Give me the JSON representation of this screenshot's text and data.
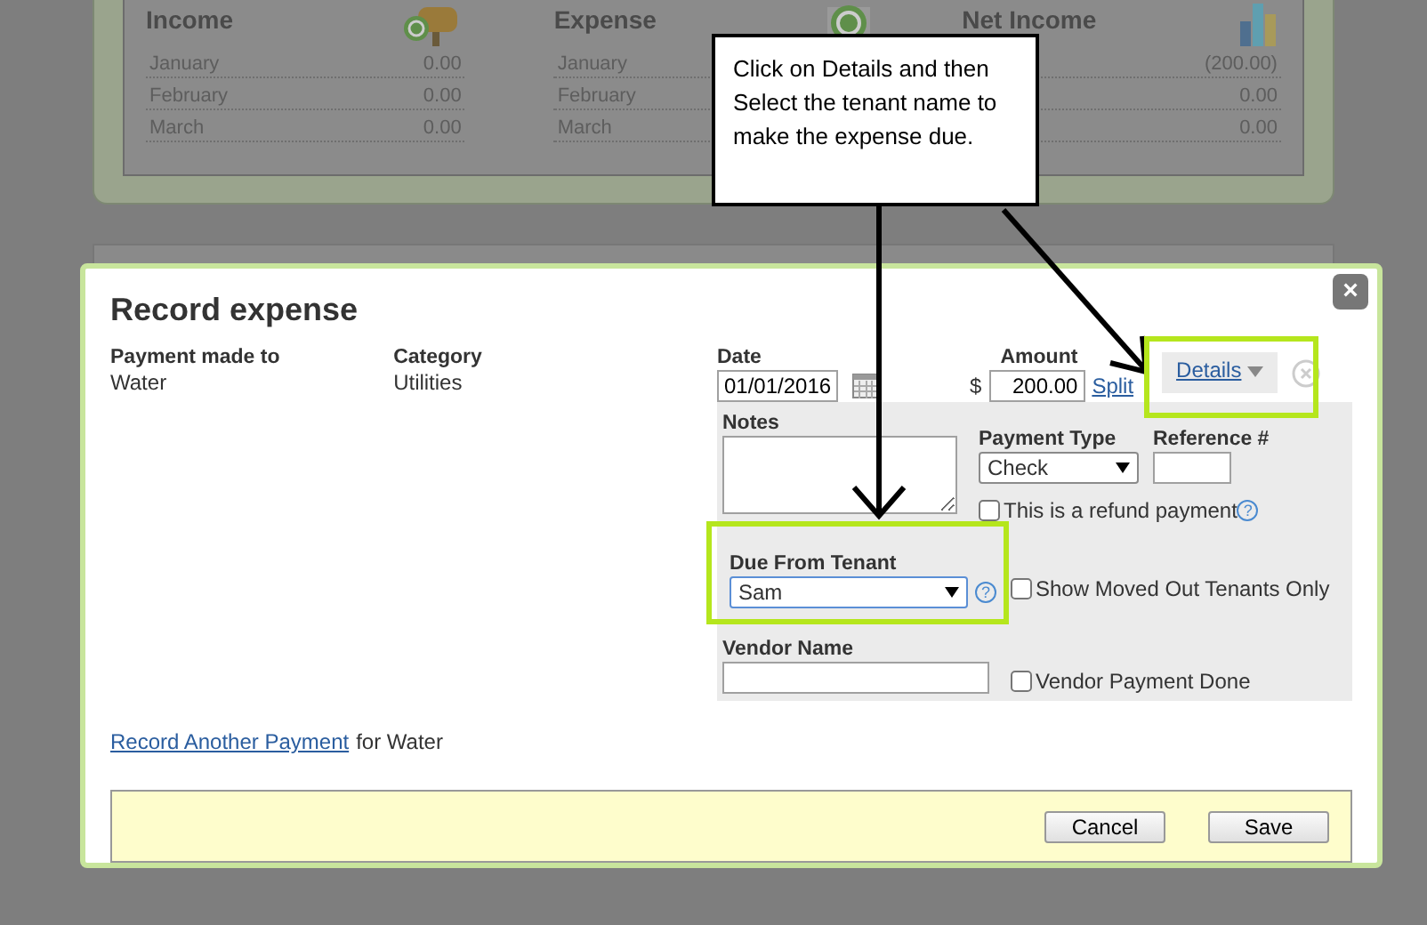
{
  "summary": [
    {
      "title": "Income",
      "rows": [
        {
          "month": "January",
          "amount": "0.00"
        },
        {
          "month": "February",
          "amount": "0.00"
        },
        {
          "month": "March",
          "amount": "0.00"
        }
      ]
    },
    {
      "title": "Expense",
      "rows": [
        {
          "month": "January"
        },
        {
          "month": "February"
        },
        {
          "month": "March"
        }
      ]
    },
    {
      "title": "Net Income",
      "rows": [
        {
          "amount": "(200.00)"
        },
        {
          "amount": "0.00"
        },
        {
          "amount": "0.00"
        }
      ]
    }
  ],
  "callout": {
    "text": "Click on Details and then Select the tenant name to make the expense due."
  },
  "dialog": {
    "title": "Record expense",
    "close": "×",
    "payment_made_to": {
      "label": "Payment made to",
      "value": "Water"
    },
    "category": {
      "label": "Category",
      "value": "Utilities"
    },
    "date": {
      "label": "Date",
      "value": "01/01/2016"
    },
    "amount": {
      "label": "Amount",
      "currency": "$",
      "value": "200.00"
    },
    "split_link": "Split",
    "details_tab": {
      "label": "Details",
      "selected": true
    },
    "notes": {
      "label": "Notes"
    },
    "payment_type": {
      "label": "Payment Type",
      "value": "Check"
    },
    "reference": {
      "label": "Reference #"
    },
    "refund": {
      "label": "This is a refund payment",
      "checked": false,
      "help": "?"
    },
    "due_from_tenant": {
      "label": "Due From Tenant",
      "value": "Sam",
      "help": "?"
    },
    "show_moved_out": {
      "label": "Show Moved Out Tenants Only",
      "checked": false
    },
    "vendor_name": {
      "label": "Vendor Name"
    },
    "vendor_payment_done": {
      "label": "Vendor Payment Done",
      "checked": false
    },
    "record_another": {
      "link": "Record Another Payment",
      "rest": "for Water"
    },
    "buttons": [
      "Cancel",
      "Save"
    ]
  }
}
